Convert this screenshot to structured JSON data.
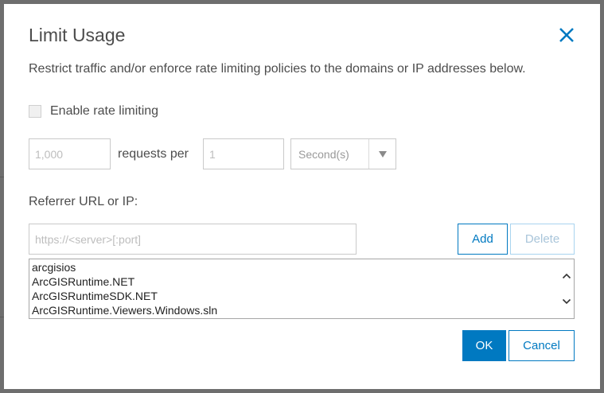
{
  "dialog": {
    "title": "Limit Usage",
    "description": "Restrict traffic and/or enforce rate limiting policies to the domains or IP addresses below."
  },
  "rate_limit": {
    "checkbox_label": "Enable rate limiting",
    "checked": false,
    "count_placeholder": "1,000",
    "requests_per_label": "requests per",
    "period_placeholder": "1",
    "unit_selected": "Second(s)"
  },
  "referrer": {
    "label": "Referrer URL or IP:",
    "input_placeholder": "https://<server>[:port]",
    "add_label": "Add",
    "delete_label": "Delete",
    "items": [
      "arcgisios",
      "ArcGISRuntime.NET",
      "ArcGISRuntimeSDK.NET",
      "ArcGISRuntime.Viewers.Windows.sln"
    ]
  },
  "footer": {
    "ok_label": "OK",
    "cancel_label": "Cancel"
  },
  "icons": {
    "close": "close-icon",
    "dropdown": "triangle-down-icon",
    "scroll_up": "chevron-up-icon",
    "scroll_down": "chevron-down-icon"
  },
  "colors": {
    "accent": "#0079c1",
    "disabled_accent": "#a9d4ef"
  }
}
